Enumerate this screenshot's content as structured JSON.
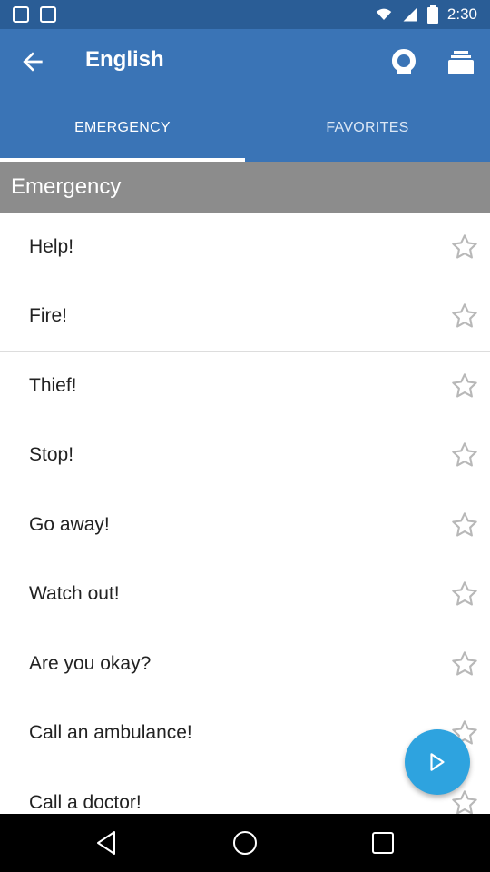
{
  "status_bar": {
    "time": "2:30",
    "icons": [
      "notification-square-icon",
      "notification-square-icon",
      "wifi-icon",
      "signal-icon",
      "battery-icon"
    ]
  },
  "app_bar": {
    "title": "English",
    "background": "#3a74b6",
    "icons": [
      "back-arrow-icon",
      "speaker-head-icon",
      "cards-stack-icon"
    ]
  },
  "tabs": [
    {
      "label": "EMERGENCY",
      "active": true
    },
    {
      "label": "FAVORITES",
      "active": false
    }
  ],
  "section": {
    "title": "Emergency"
  },
  "phrases": [
    {
      "text": "Help!"
    },
    {
      "text": "Fire!"
    },
    {
      "text": "Thief!"
    },
    {
      "text": "Stop!"
    },
    {
      "text": "Go away!"
    },
    {
      "text": "Watch out!"
    },
    {
      "text": "Are you okay?"
    },
    {
      "text": "Call an ambulance!"
    },
    {
      "text": "Call a doctor!"
    }
  ],
  "fab": {
    "icon": "play-icon",
    "color": "#2ea3df"
  },
  "nav_bar": {
    "icons": [
      "nav-back-icon",
      "nav-home-icon",
      "nav-recents-icon"
    ]
  }
}
